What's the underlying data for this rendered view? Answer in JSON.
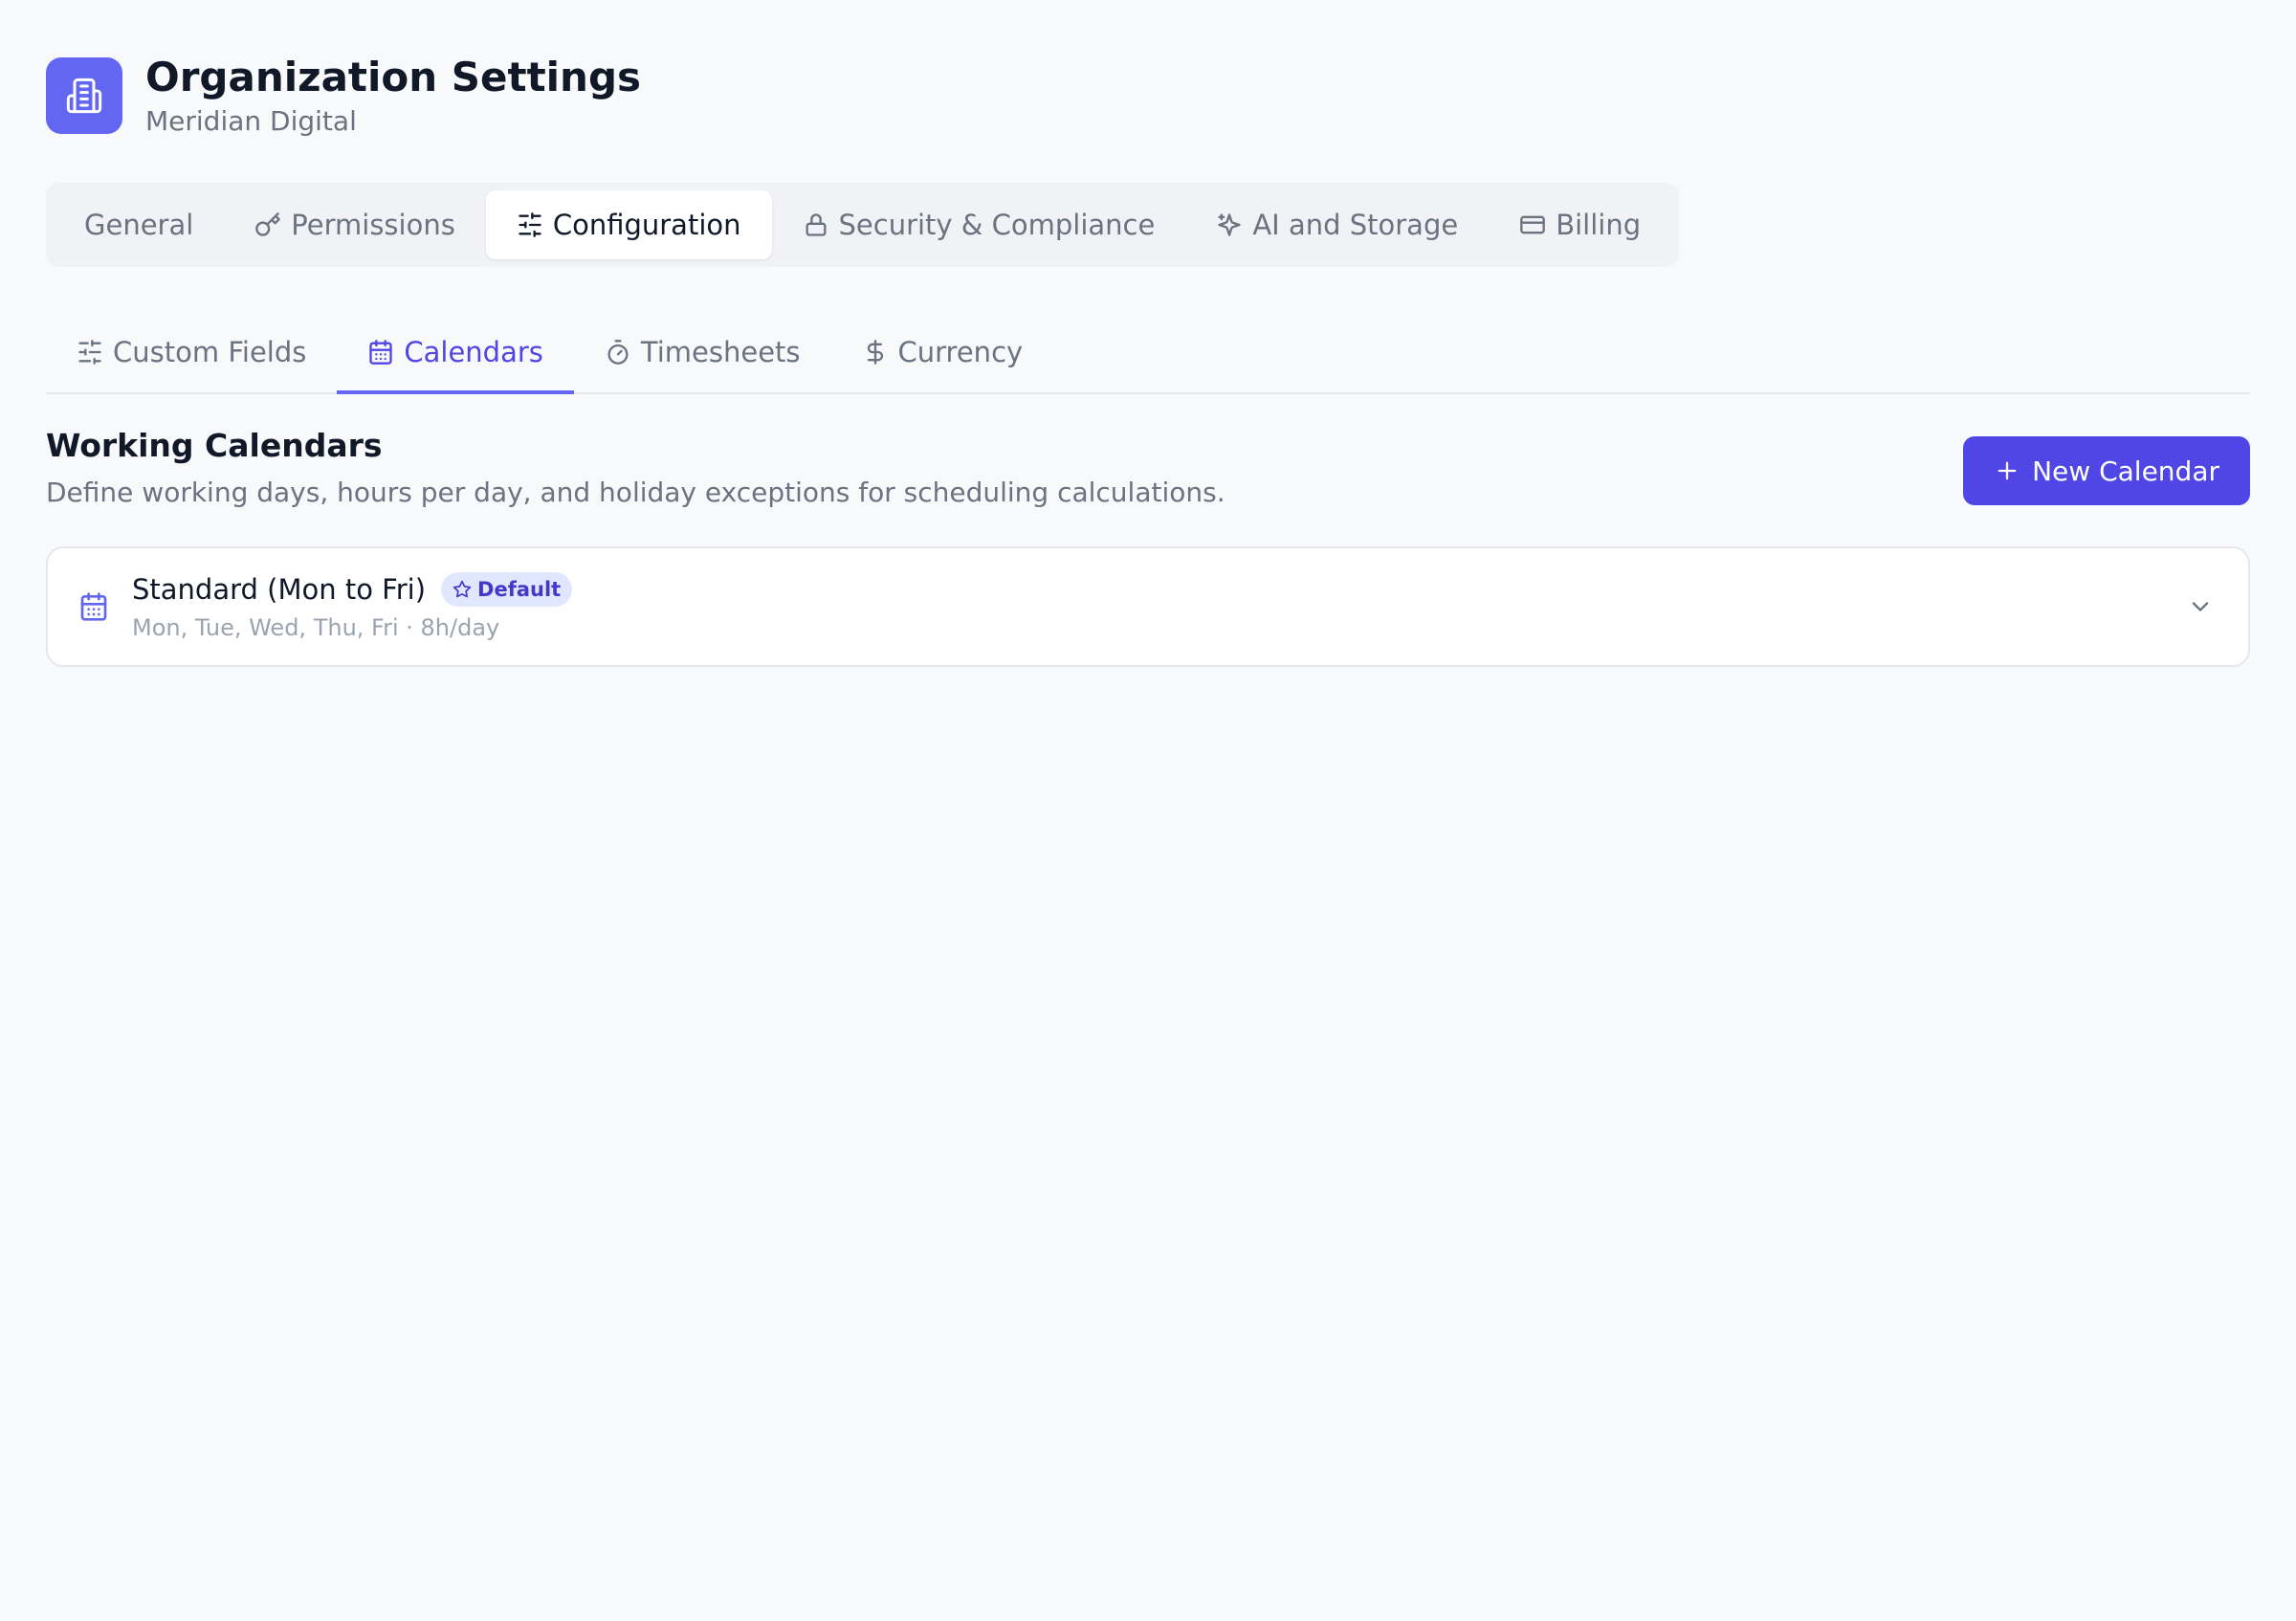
{
  "header": {
    "title": "Organization Settings",
    "subtitle": "Meridian Digital",
    "icon": "building-icon"
  },
  "main_tabs": [
    {
      "label": "General",
      "icon": ""
    },
    {
      "label": "Permissions",
      "icon": "key-icon"
    },
    {
      "label": "Configuration",
      "icon": "sliders-icon",
      "active": true
    },
    {
      "label": "Security & Compliance",
      "icon": "lock-icon"
    },
    {
      "label": "AI and Storage",
      "icon": "sparkles-icon"
    },
    {
      "label": "Billing",
      "icon": "credit-card-icon"
    }
  ],
  "sub_tabs": [
    {
      "label": "Custom Fields",
      "icon": "sliders-icon"
    },
    {
      "label": "Calendars",
      "icon": "calendar-icon",
      "active": true
    },
    {
      "label": "Timesheets",
      "icon": "timer-icon"
    },
    {
      "label": "Currency",
      "icon": "dollar-icon"
    }
  ],
  "section": {
    "title": "Working Calendars",
    "description": "Define working days, hours per day, and holiday exceptions for scheduling calculations.",
    "new_button_label": "New Calendar"
  },
  "calendars": [
    {
      "name": "Standard (Mon to Fri)",
      "badge": "Default",
      "meta": "Mon, Tue, Wed, Thu, Fri · 8h/day"
    }
  ],
  "colors": {
    "accent": "#4f46e5",
    "accent_light": "#6366f1",
    "badge_bg": "#e0e7ff",
    "background": "#f8f9fb"
  }
}
